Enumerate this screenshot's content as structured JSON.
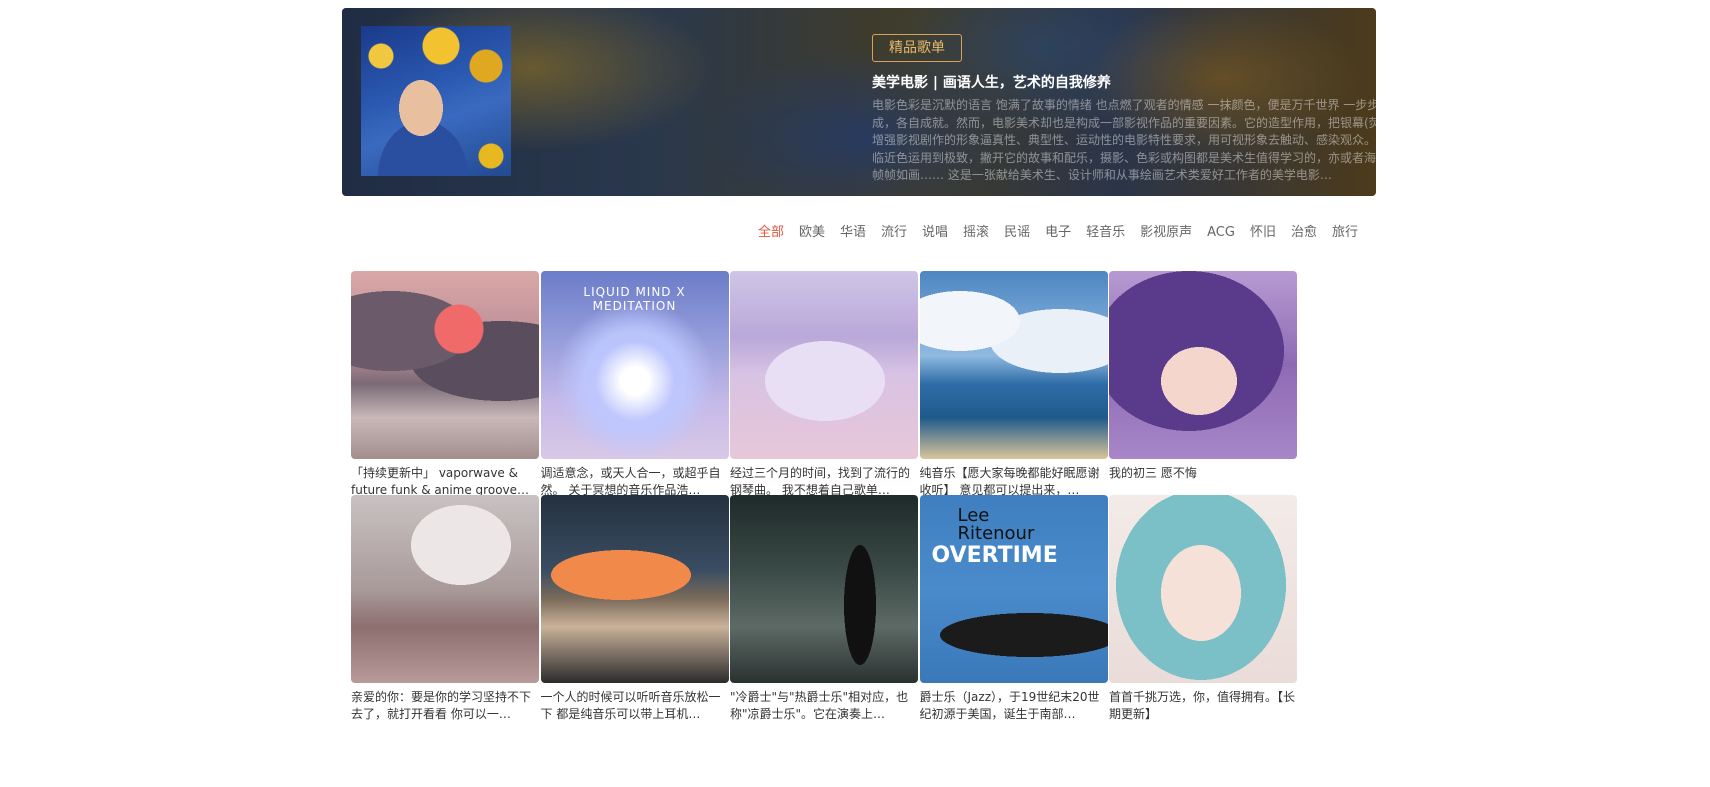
{
  "banner": {
    "tag": "精品歌单",
    "title": "美学电影 | 画语人生，艺术的自我修养",
    "description": "电影色彩是沉默的语言 饱满了故事的情绪 也点燃了观者的情感 一抹颜色，便是万千世界 一步步将你代入另一个时空 一部好电影，少不了美妙配乐的相辅相成，各自成就。然而，电影美术却也是构成一部影视作品的重要因素。它的造型作用，把银幕(荧幕)画面中的光，色彩，线条，形体，结构有机的组合起来，增强影视剧作的形象逼真性、典型性、运动性的电影特性要求，用可视形象去触动、感染观众。如布达佩斯大饭店中营造的神秘浪漫的童话氛围，互补色和临近色运用到极致，撇开它的故事和配乐，摄影、色彩或构图都是美术生值得学习的，亦或者海洋之歌的精美绝伦，运用了大量的对称、线条、几何美学，帧帧如画…… 这是一张献给美术生、设计师和从事绘画艺术类爱好工作者的美学电影…"
  },
  "categories": [
    "全部",
    "欧美",
    "华语",
    "流行",
    "说唱",
    "摇滚",
    "民谣",
    "电子",
    "轻音乐",
    "影视原声",
    "ACG",
    "怀旧",
    "治愈",
    "旅行"
  ],
  "active_category": "全部",
  "playlists": [
    {
      "caption": "「持续更新中」 vaporwave & future funk & anime groove等…",
      "art": "t1"
    },
    {
      "caption": "调适意念，或天人合一，或超乎自然。 关于冥想的音乐作品浩…",
      "art": "t2",
      "cover_text": "LIQUID MIND X\nMEDITATION"
    },
    {
      "caption": "经过三个月的时间，找到了流行的钢琴曲。 我不想着自己歌单…",
      "art": "t3"
    },
    {
      "caption": "纯音乐【愿大家每晚都能好眠愿谢收听】 意见都可以提出来，…",
      "art": "t4"
    },
    {
      "caption": "我的初三 愿不悔",
      "art": "t5"
    },
    {
      "caption": "亲爱的你：要是你的学习坚持不下去了，就打开看看 你可以一…",
      "art": "t6"
    },
    {
      "caption": "一个人的时候可以听听音乐放松一下 都是纯音乐可以带上耳机…",
      "art": "t7"
    },
    {
      "caption": "\"冷爵士\"与\"热爵士乐\"相对应，也称\"凉爵士乐\"。它在演奏上…",
      "art": "t8"
    },
    {
      "caption": "爵士乐（Jazz），于19世纪末20世纪初源于美国，诞生于南部…",
      "art": "t9",
      "cover_lines": [
        "Lee",
        "Ritenour",
        "OVERTIME"
      ]
    },
    {
      "caption": "首首千挑万选，你，值得拥有。【长期更新】",
      "art": "t10"
    }
  ],
  "colors": {
    "accent": "#e0553e",
    "tag_border": "#d9a25a"
  }
}
